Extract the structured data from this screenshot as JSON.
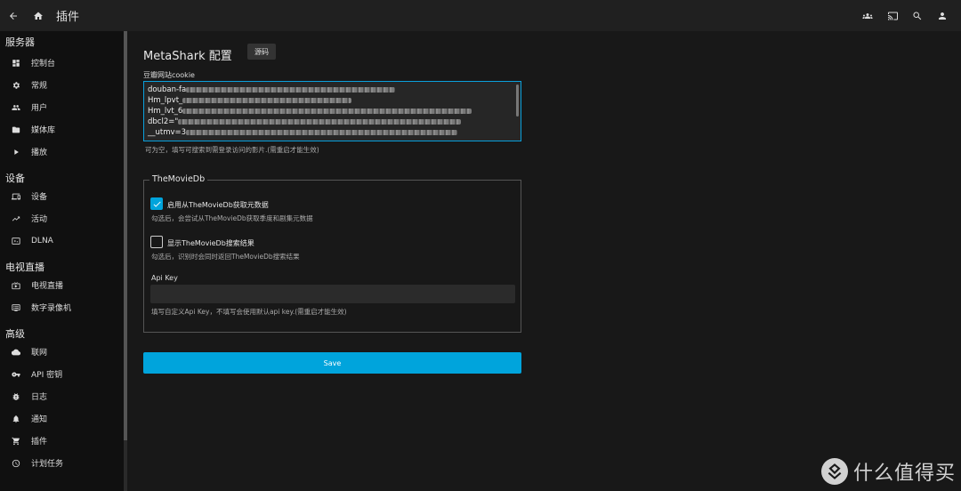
{
  "header": {
    "title": "插件",
    "icons": [
      "back-arrow-icon",
      "home-icon",
      "users-icon",
      "cast-icon",
      "search-icon",
      "account-icon"
    ]
  },
  "sidebar": {
    "sections": [
      {
        "title": "服务器",
        "items": [
          {
            "label": "控制台",
            "icon": "dashboard-icon"
          },
          {
            "label": "常规",
            "icon": "gear-icon"
          },
          {
            "label": "用户",
            "icon": "users-icon"
          },
          {
            "label": "媒体库",
            "icon": "folder-icon"
          },
          {
            "label": "播放",
            "icon": "play-icon"
          }
        ]
      },
      {
        "title": "设备",
        "items": [
          {
            "label": "设备",
            "icon": "devices-icon"
          },
          {
            "label": "活动",
            "icon": "activity-icon"
          },
          {
            "label": "DLNA",
            "icon": "dlna-icon"
          }
        ]
      },
      {
        "title": "电视直播",
        "items": [
          {
            "label": "电视直播",
            "icon": "live-tv-icon"
          },
          {
            "label": "数字录像机",
            "icon": "dvr-icon"
          }
        ]
      },
      {
        "title": "高级",
        "items": [
          {
            "label": "联网",
            "icon": "cloud-icon"
          },
          {
            "label": "API 密钥",
            "icon": "key-icon"
          },
          {
            "label": "日志",
            "icon": "bug-icon"
          },
          {
            "label": "通知",
            "icon": "bell-icon"
          },
          {
            "label": "插件",
            "icon": "cart-icon"
          },
          {
            "label": "计划任务",
            "icon": "clock-icon"
          }
        ]
      }
    ]
  },
  "main": {
    "plugin_title": "MetaShark 配置",
    "source_button": "源码",
    "cookie": {
      "label": "豆瓣网站cookie",
      "lines": [
        "douban-fa",
        "Hm_lpvt_",
        "Hm_lvt_6",
        "dbcl2=\"",
        "__utmv=3"
      ],
      "help": "可为空，填写可搜索到需登录访问的影片.(需重启才能生效)"
    },
    "tmdb": {
      "legend": "TheMovieDb",
      "enable_label": "启用从TheMovieDb获取元数据",
      "enable_help": "勾选后，会尝试从TheMovieDb获取季度和剧集元数据",
      "enable_checked": true,
      "show_label": "显示TheMovieDb搜索结果",
      "show_help": "勾选后，识别时会同时返回TheMovieDb搜索结果",
      "show_checked": false,
      "api_label": "Api Key",
      "api_value": "",
      "api_help": "填写自定义Api Key，不填写会使用默认api key.(需重启才能生效)"
    },
    "save_label": "Save"
  },
  "watermark": {
    "text": "什么值得买"
  },
  "colors": {
    "accent": "#00a4dc",
    "background": "#181818",
    "sidebar": "#101010"
  }
}
